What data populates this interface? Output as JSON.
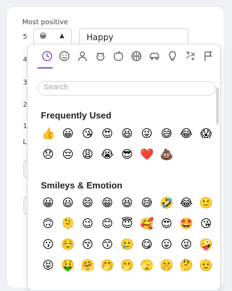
{
  "form": {
    "section_label": "Most positive",
    "row_numbers": [
      "5",
      "4",
      "3",
      "2",
      "1"
    ],
    "selected_emoji": "😀",
    "text_value": "Happy",
    "lea_label": "Lea"
  },
  "picker": {
    "categories": [
      {
        "name": "recent-icon"
      },
      {
        "name": "smileys-icon"
      },
      {
        "name": "people-icon"
      },
      {
        "name": "animals-icon"
      },
      {
        "name": "food-icon"
      },
      {
        "name": "activity-icon"
      },
      {
        "name": "travel-icon"
      },
      {
        "name": "objects-icon"
      },
      {
        "name": "symbols-icon"
      },
      {
        "name": "flags-icon"
      }
    ],
    "search_placeholder": "Search",
    "groups": [
      {
        "title": "Frequently Used",
        "emojis": [
          "👍",
          "😀",
          "😘",
          "😍",
          "😆",
          "😜",
          "😅",
          "😂",
          "😱",
          "😞",
          "😔",
          "😩",
          "😭",
          "😎",
          "❤️",
          "💩"
        ]
      },
      {
        "title": "Smileys & Emotion",
        "emojis": [
          "😀",
          "😃",
          "😄",
          "😁",
          "😆",
          "😅",
          "🤣",
          "😂",
          "🙂",
          "🙃",
          "🫠",
          "😉",
          "😊",
          "😇",
          "🥰",
          "😍",
          "🤩",
          "😘",
          "😗",
          "☺️",
          "😚",
          "😙",
          "🥲",
          "😋",
          "😛",
          "😜",
          "🤪",
          "😝",
          "🤑",
          "🤗",
          "🤭",
          "🫢",
          "🫣",
          "🤫",
          "🤔",
          "🫡"
        ]
      }
    ]
  }
}
